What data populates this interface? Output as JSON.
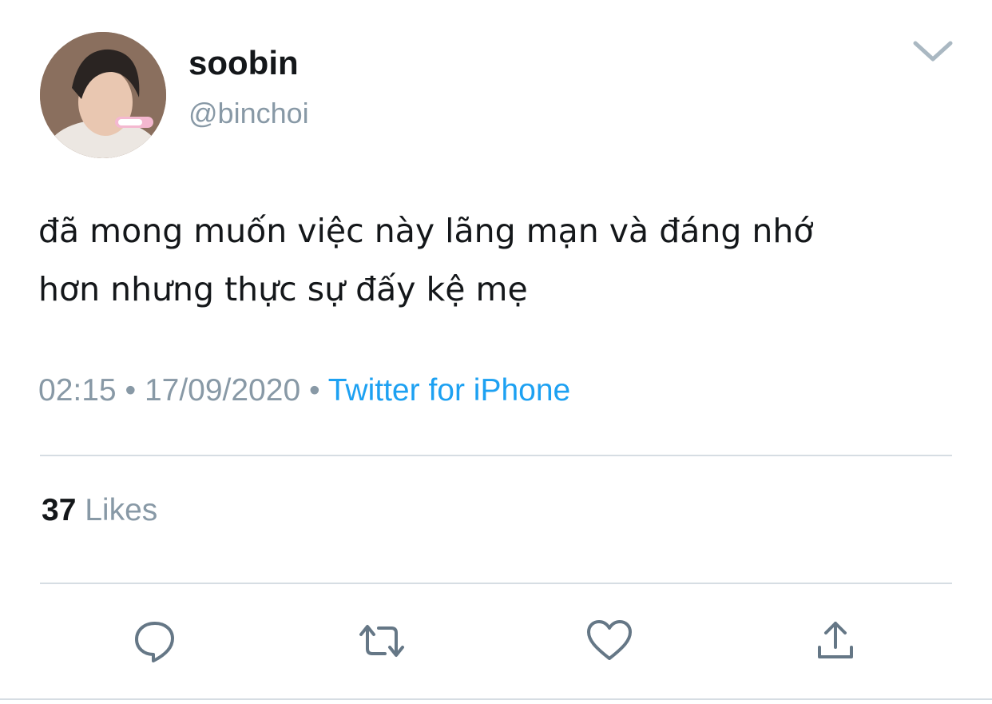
{
  "user": {
    "display_name": "soobin",
    "handle": "@binchoi",
    "avatar_icon": "profile-photo"
  },
  "tweet": {
    "text": "đã mong muốn việc này lãng mạn và đáng nhớ\nhơn nhưng thực sự đấy kệ mẹ"
  },
  "meta": {
    "time": "02:15",
    "separator": " • ",
    "date": "17/09/2020",
    "source": "Twitter for iPhone"
  },
  "engagement": {
    "likes_count": "37",
    "likes_label": "Likes"
  },
  "actions": [
    {
      "icon": "reply-icon"
    },
    {
      "icon": "retweet-icon"
    },
    {
      "icon": "heart-icon"
    },
    {
      "icon": "share-icon"
    }
  ],
  "colors": {
    "text": "#14171a",
    "secondary": "#8899a6",
    "link": "#1da1f2",
    "divider": "#d6dde3"
  }
}
